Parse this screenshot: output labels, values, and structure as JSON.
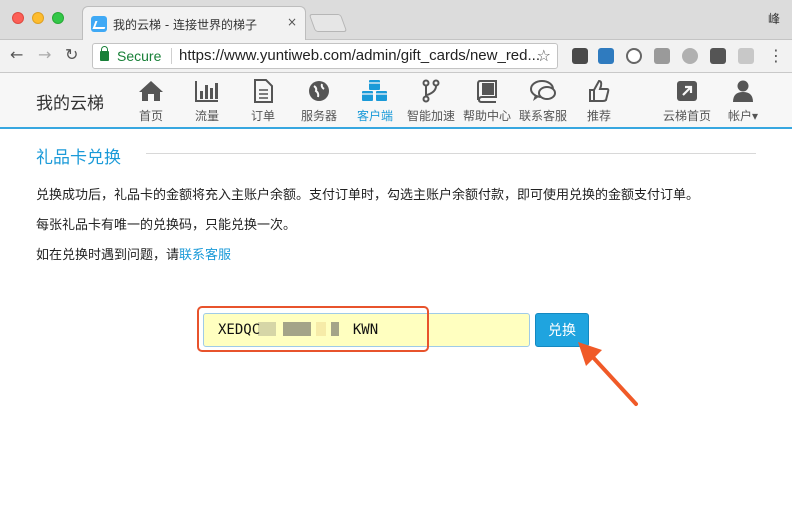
{
  "browser": {
    "tab_title": "我的云梯 - 连接世界的梯子",
    "tab_close": "×",
    "profile_name": "峰",
    "back": "←",
    "forward": "→",
    "reload": "↻",
    "secure_label": "Secure",
    "url": "https://www.yuntiweb.com/admin/gift_cards/new_red...",
    "bookmark": "☆",
    "menu": "⋮",
    "extensions": [
      {
        "name": "evernote-icon",
        "color": "#4a4a4a"
      },
      {
        "name": "s-extension-icon",
        "color": "#2f7bbf"
      },
      {
        "name": "info-icon",
        "color": "#666666"
      },
      {
        "name": "dropbox-icon",
        "color": "#9a9a9a"
      },
      {
        "name": "chat-extension-icon",
        "color": "#b0b0b0"
      },
      {
        "name": "mail-check-icon",
        "color": "#555555"
      }
    ]
  },
  "site": {
    "logo": "我的云梯",
    "accent_color": "#1a9ad8",
    "nav": [
      {
        "label": "首页",
        "icon": "home-icon"
      },
      {
        "label": "流量",
        "icon": "bar-chart-icon"
      },
      {
        "label": "订单",
        "icon": "document-icon"
      },
      {
        "label": "服务器",
        "icon": "globe-icon"
      },
      {
        "label": "客户端",
        "icon": "cubes-icon",
        "active": true
      },
      {
        "label": "智能加速",
        "icon": "branch-icon"
      },
      {
        "label": "帮助中心",
        "icon": "book-icon"
      },
      {
        "label": "联系客服",
        "icon": "chat-icon"
      },
      {
        "label": "推荐",
        "icon": "thumbs-up-icon"
      }
    ],
    "right_nav": [
      {
        "label": "云梯首页",
        "icon": "external-link-icon"
      },
      {
        "label": "帐户",
        "icon": "user-icon",
        "caret": "▾"
      }
    ]
  },
  "content": {
    "title": "礼品卡兑换",
    "para1": "兑换成功后，礼品卡的金额将充入主账户余额。支付订单时，勾选主账户余额付款，即可使用兑换的金额支付订单。",
    "para2": "每张礼品卡有唯一的兑换码，只能兑换一次。",
    "para3_prefix": "如在兑换时遇到问题，请",
    "para3_link": "联系客服",
    "code_value": "XEDQC           KWN",
    "redeem_label": "兑换"
  }
}
